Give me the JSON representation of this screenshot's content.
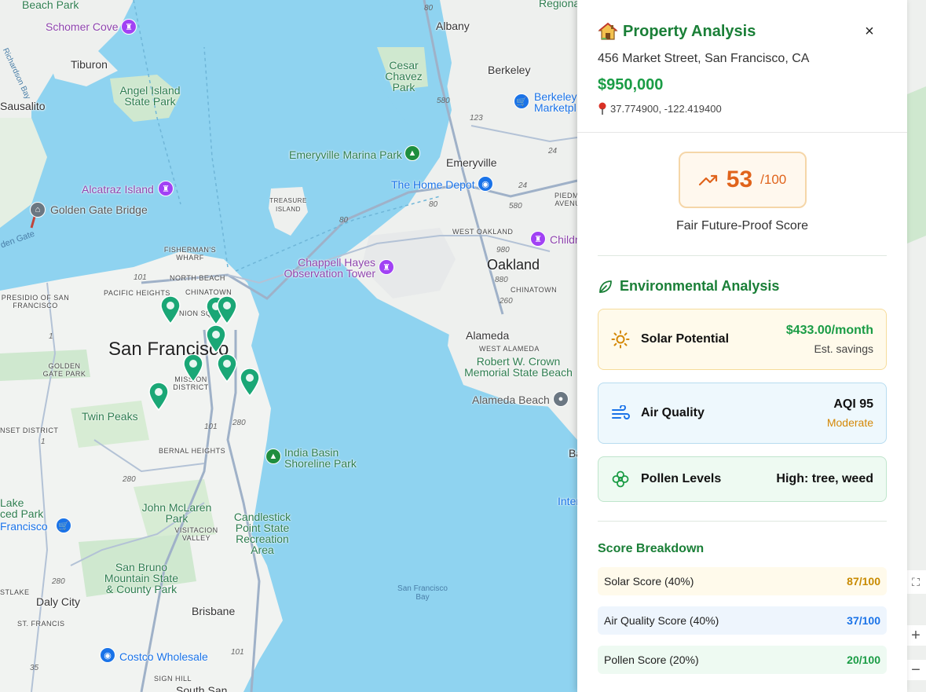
{
  "map": {
    "places": {
      "beach_park": "Beach Park",
      "schomer_cove": "Schomer Cove",
      "richardson_bay": "Richardson Bay",
      "tiburon": "Tiburon",
      "angel_island": "Angel Island State Park",
      "sausalito": "Sausalito",
      "alcatraz": "Alcatraz Island",
      "golden_gate_bridge": "Golden Gate Bridge",
      "golden_gate": "den Gate",
      "treasure_island": "TREASURE ISLAND",
      "fishermans_wharf": "FISHERMAN'S WHARF",
      "north_beach": "NORTH BEACH",
      "pacific_heights": "PACIFIC HEIGHTS",
      "chinatown": "CHINATOWN",
      "union_sq": "NION SQ",
      "presidio": "PRESIDIO OF SAN FRANCISCO",
      "san_francisco": "San Francisco",
      "golden_gate_park": "GOLDEN GATE PARK",
      "mission": "MISSION DISTRICT",
      "twin_peaks": "Twin Peaks",
      "sunset": "NSET DISTRICT",
      "bernal": "BERNAL HEIGHTS",
      "india_basin": "India Basin Shoreline Park",
      "mclaren": "John McLaren Park",
      "visitacion": "VISITACION VALLEY",
      "candlestick": "Candlestick Point State Recreation Area",
      "lake": "Lake",
      "ced_park": "ced Park",
      "francisco": "Francisco",
      "san_bruno": "San Bruno Mountain State & County Park",
      "stlake": "STLAKE",
      "daly_city": "Daly City",
      "brisbane": "Brisbane",
      "st_francis": "ST. FRANCIS",
      "costco": "Costco Wholesale",
      "sign_hill": "SIGN HILL",
      "south_san": "South San",
      "sf_bay": "San Francisco Bay",
      "regional": "Regiona",
      "albany": "Albany",
      "cesar_chavez": "Cesar Chavez Park",
      "berkeley": "Berkeley",
      "berkeley_market": "Berkeley Marketpl",
      "emeryville_marina": "Emeryville Marina Park",
      "emeryville": "Emeryville",
      "home_depot": "The Home Depot",
      "piedmont": "PIEDMONT AVENUE",
      "west_oakland": "WEST OAKLAND",
      "childr": "Childr",
      "chappell": "Chappell Hayes Observation Tower",
      "oakland": "Oakland",
      "chinatown_oak": "CHINATOWN",
      "alameda": "Alameda",
      "west_alameda": "WEST ALAMEDA",
      "crown_beach": "Robert W. Crown Memorial State Beach",
      "alameda_beach": "Alameda Beach",
      "ba": "Ba",
      "inter": "Inter"
    },
    "roads": [
      "80",
      "580",
      "123",
      "24",
      "24",
      "80",
      "580",
      "980",
      "880",
      "260",
      "101",
      "1",
      "101",
      "280",
      "280",
      "1",
      "280",
      "101",
      "35",
      "101",
      "80"
    ]
  },
  "panel": {
    "title": "Property Analysis",
    "address": "456 Market Street, San Francisco, CA",
    "price": "$950,000",
    "coords": "37.774900, -122.419400",
    "close_symbol": "×",
    "score": {
      "value": "53",
      "max": "/100",
      "label": "Fair Future-Proof Score",
      "fraction": 0.53,
      "color": "#e0631b"
    },
    "environment": {
      "title": "Environmental Analysis",
      "solar": {
        "name": "Solar Potential",
        "value": "$433.00/month",
        "sub": "Est. savings",
        "icon": "sun-icon",
        "color": "#1a9c45"
      },
      "air": {
        "name": "Air Quality",
        "value": "AQI 95",
        "sub": "Moderate",
        "icon": "wind-icon",
        "sub_color": "#d48806"
      },
      "pollen": {
        "name": "Pollen Levels",
        "value": "High: tree, weed",
        "icon": "flower-icon"
      }
    },
    "breakdown": {
      "title": "Score Breakdown",
      "rows": [
        {
          "label": "Solar Score (40%)",
          "value": "87/100",
          "color": "#c88a00",
          "bg": "#fffaeb"
        },
        {
          "label": "Air Quality Score (40%)",
          "value": "37/100",
          "color": "#1a73e8",
          "bg": "#eef5fd"
        },
        {
          "label": "Pollen Score (20%)",
          "value": "20/100",
          "color": "#1a9c45",
          "bg": "#eefaf2"
        }
      ]
    }
  }
}
